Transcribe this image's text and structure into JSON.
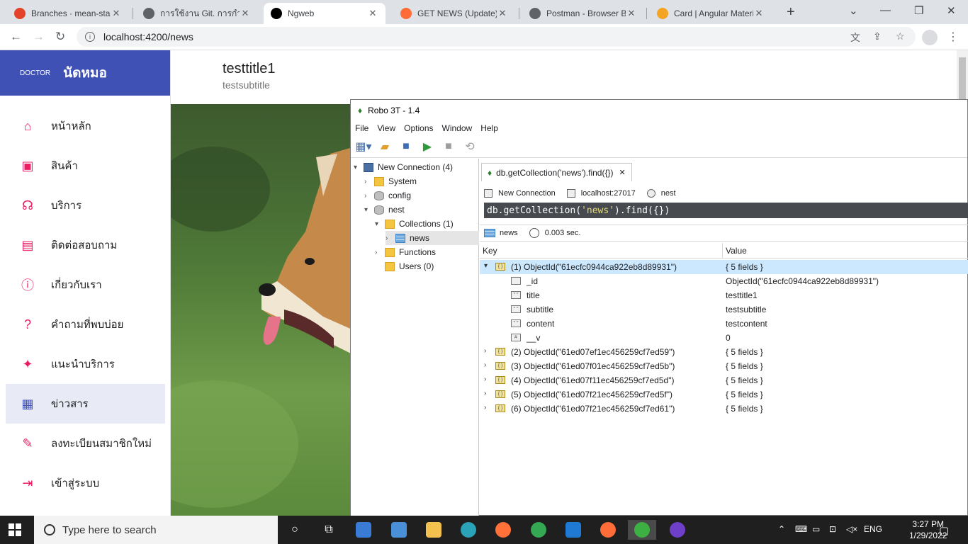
{
  "browser": {
    "tabs": [
      {
        "title": "Branches · mean-stack",
        "favicon_color": "#e24329"
      },
      {
        "title": "การใช้งาน Git. การกำหนด",
        "favicon_color": "#5f6368"
      },
      {
        "title": "Ngweb",
        "favicon_color": "#000000"
      },
      {
        "title": "GET NEWS (Update) -",
        "favicon_color": "#ff6c37"
      },
      {
        "title": "Postman - Browser Ba",
        "favicon_color": "#5f6368"
      },
      {
        "title": "Card | Angular Materia",
        "favicon_color": "#f4a322"
      }
    ],
    "active_tab_index": 2,
    "url": "localhost:4200/news"
  },
  "app": {
    "brand_small": "DOCTOR",
    "brand_title": "นัดหมอ",
    "brand_color": "#3f51b5",
    "accent_color": "#e91e63",
    "nav": [
      {
        "label": "หน้าหลัก",
        "icon": "home-icon",
        "glyph": "⌂"
      },
      {
        "label": "สินค้า",
        "icon": "archive-icon",
        "glyph": "▣"
      },
      {
        "label": "บริการ",
        "icon": "headset-icon",
        "glyph": "☊"
      },
      {
        "label": "ติดต่อสอบถาม",
        "icon": "contact-card-icon",
        "glyph": "▤"
      },
      {
        "label": "เกี่ยวกับเรา",
        "icon": "info-icon",
        "glyph": "ⓘ"
      },
      {
        "label": "คำถามที่พบบ่อย",
        "icon": "quiz-icon",
        "glyph": "?"
      },
      {
        "label": "แนะนำบริการ",
        "icon": "recommend-icon",
        "glyph": "✦"
      },
      {
        "label": "ข่าวสาร",
        "icon": "calendar-icon",
        "glyph": "▦"
      },
      {
        "label": "ลงทะเบียนสมาชิกใหม่",
        "icon": "register-icon",
        "glyph": "✎"
      },
      {
        "label": "เข้าสู่ระบบ",
        "icon": "login-icon",
        "glyph": "⇥"
      }
    ],
    "selected_nav_index": 7,
    "card": {
      "title": "testtitle1",
      "subtitle": "testsubtitle"
    }
  },
  "robo": {
    "window_title": "Robo 3T - 1.4",
    "menu": [
      "File",
      "View",
      "Options",
      "Window",
      "Help"
    ],
    "tree": [
      {
        "label": "New Connection (4)",
        "level": 0,
        "icon": "pc",
        "arrow": "▾"
      },
      {
        "label": "System",
        "level": 1,
        "icon": "folder",
        "arrow": "›"
      },
      {
        "label": "config",
        "level": 1,
        "icon": "db",
        "arrow": "›"
      },
      {
        "label": "nest",
        "level": 1,
        "icon": "db",
        "arrow": "▾"
      },
      {
        "label": "Collections (1)",
        "level": 2,
        "icon": "folder",
        "arrow": "▾"
      },
      {
        "label": "news",
        "level": 3,
        "icon": "grid-ico",
        "arrow": "›"
      },
      {
        "label": "Functions",
        "level": 2,
        "icon": "folder",
        "arrow": "›"
      },
      {
        "label": "Users (0)",
        "level": 2,
        "icon": "folder",
        "arrow": ""
      }
    ],
    "query_tab": "db.getCollection('news').find({})",
    "conn_name": "New Connection",
    "host": "localhost:27017",
    "db_name": "nest",
    "query_prefix": "db.getCollection(",
    "query_string": "'news'",
    "query_suffix": ").find({})",
    "result_collection": "news",
    "result_time": "0.003 sec.",
    "col_key": "Key",
    "col_value": "Value",
    "rows": [
      {
        "key": "(1) ObjectId(\"61ecfc0944ca922eb8d89931\")",
        "value": "{ 5 fields }",
        "level": 0,
        "arrow": "▾",
        "type": "obj",
        "highlight": true
      },
      {
        "key": "_id",
        "value": "ObjectId(\"61ecfc0944ca922eb8d89931\")",
        "level": 1,
        "arrow": "",
        "type": "id"
      },
      {
        "key": "title",
        "value": "testtitle1",
        "level": 1,
        "arrow": "",
        "type": "str"
      },
      {
        "key": "subtitle",
        "value": "testsubtitle",
        "level": 1,
        "arrow": "",
        "type": "str"
      },
      {
        "key": "content",
        "value": "testcontent",
        "level": 1,
        "arrow": "",
        "type": "str"
      },
      {
        "key": "__v",
        "value": "0",
        "level": 1,
        "arrow": "",
        "type": "num"
      },
      {
        "key": "(2) ObjectId(\"61ed07ef1ec456259cf7ed59\")",
        "value": "{ 5 fields }",
        "level": 0,
        "arrow": "›",
        "type": "obj"
      },
      {
        "key": "(3) ObjectId(\"61ed07f01ec456259cf7ed5b\")",
        "value": "{ 5 fields }",
        "level": 0,
        "arrow": "›",
        "type": "obj"
      },
      {
        "key": "(4) ObjectId(\"61ed07f11ec456259cf7ed5d\")",
        "value": "{ 5 fields }",
        "level": 0,
        "arrow": "›",
        "type": "obj"
      },
      {
        "key": "(5) ObjectId(\"61ed07f21ec456259cf7ed5f\")",
        "value": "{ 5 fields }",
        "level": 0,
        "arrow": "›",
        "type": "obj"
      },
      {
        "key": "(6) ObjectId(\"61ed07f21ec456259cf7ed61\")",
        "value": "{ 5 fields }",
        "level": 0,
        "arrow": "›",
        "type": "obj"
      }
    ]
  },
  "taskbar": {
    "search_placeholder": "Type here to search",
    "time": "3:27 PM",
    "date": "1/29/2022",
    "lang": "ENG"
  }
}
